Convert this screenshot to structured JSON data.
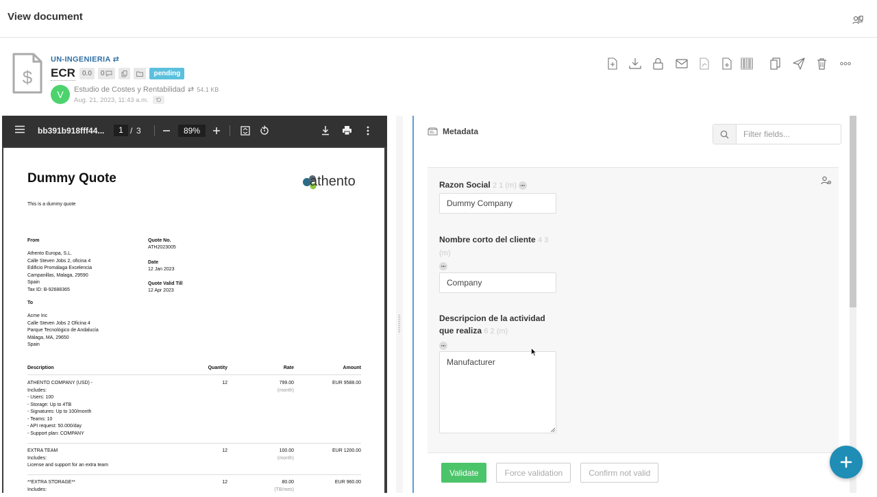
{
  "header": {
    "title": "View document"
  },
  "doc": {
    "company": "UN-INGENIERIA",
    "type": "ECR",
    "version": "0.0",
    "comments": "0",
    "status": "pending",
    "author_initial": "V",
    "doc_name": "Estudio de Costes y Rentabilidad",
    "size": "54.1 KB",
    "date": "Aug. 21, 2023, 11:43 a.m."
  },
  "toolbar_icons": [
    "add-file-icon",
    "download-icon",
    "lock-icon",
    "mail-icon",
    "pdf-icon",
    "new-document-icon",
    "barcode-icon",
    "copy-icon",
    "send-icon",
    "trash-icon",
    "more-icon"
  ],
  "pdf": {
    "filename": "bb391b918fff44...",
    "page": "1",
    "page_sep": "/",
    "total_pages": "3",
    "zoom": "89%",
    "content": {
      "title": "Dummy Quote",
      "logo_text": "athento",
      "subtitle": "This is a dummy quote",
      "from_label": "From",
      "from_lines": [
        "Athento Europa, S.L.",
        "Calle Steven Jobs 2, oficina 4",
        "Edificio Promálaga Excelencia",
        "Campanillas, Malaga, 29590",
        "Spain",
        "Tax ID: B-92688365"
      ],
      "quote_no_label": "Quote No.",
      "quote_no": "ATH2023005",
      "date_label": "Date",
      "date": "12 Jan 2023",
      "valid_label": "Quote Valid Till",
      "valid": "12 Apr 2023",
      "to_label": "To",
      "to_lines": [
        "Acme Inc",
        "Calle Steven Jobs 2 Oficina 4",
        "Parque Tecnológico de Andalucía",
        "Málaga, MA, 29650",
        "Spain"
      ],
      "table_headers": {
        "description": "Description",
        "quantity": "Quantity",
        "rate": "Rate",
        "amount": "Amount"
      },
      "rows": [
        {
          "desc": [
            "ATHENTO COMPANY (USD) -",
            "Includes:",
            "- Users: 100",
            "- Storage: Up to 4TB",
            "- Signatures: Up to 100/month",
            "- Teams: 10",
            "- API request: 50.000/day",
            "- Support plan: COMPANY"
          ],
          "qty": "12",
          "rate": "799.00",
          "unit": "(month)",
          "amount": "EUR 9588.00"
        },
        {
          "desc": [
            "EXTRA TEAM",
            "Includes:",
            "License and support for an extra team"
          ],
          "qty": "12",
          "rate": "100.00",
          "unit": "(month)",
          "amount": "EUR 1200.00"
        },
        {
          "desc": [
            "**EXTRA STORAGE**",
            "Includes:"
          ],
          "qty": "12",
          "rate": "80.00",
          "unit": "(TB/mes)",
          "amount": "EUR 960.00"
        }
      ]
    }
  },
  "metadata": {
    "title": "Metadata",
    "filter_placeholder": "Filter fields...",
    "fields": [
      {
        "label": "Razon Social",
        "meta": "2 1 (m)",
        "value": "Dummy Company"
      },
      {
        "label": "Nombre corto del cliente",
        "meta": "4 3 (m)",
        "value": "Company"
      },
      {
        "label": "Descripcion de la actividad que realiza",
        "meta": "6 2 (m)",
        "value": "Manufacturer"
      }
    ],
    "buttons": {
      "validate": "Validate",
      "force": "Force validation",
      "confirm": "Confirm not valid"
    }
  },
  "fab_label": "+",
  "colors": {
    "accent": "#2f6fa3",
    "pending": "#5bc0de",
    "validate": "#4cc46a",
    "fab": "#1f8db5",
    "avatar": "#4cd36e",
    "panel_border": "#5b9bd5"
  }
}
